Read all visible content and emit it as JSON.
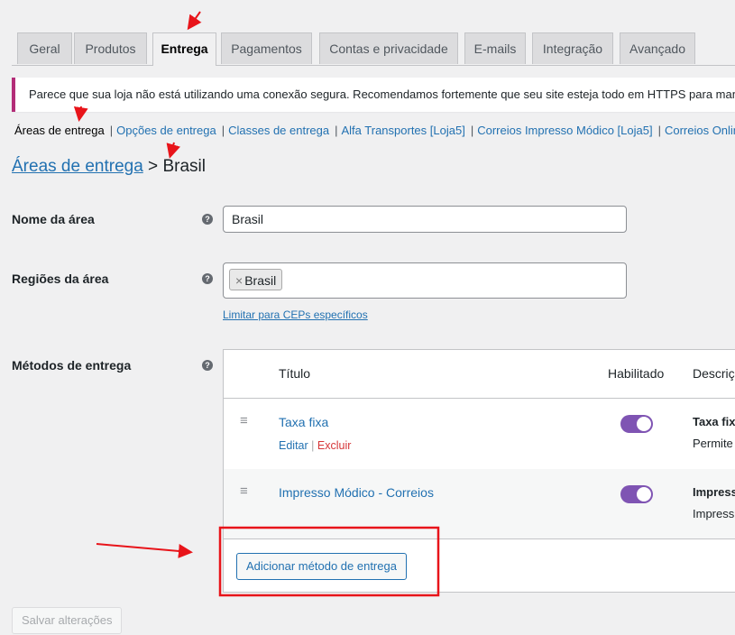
{
  "tabs": [
    "Geral",
    "Produtos",
    "Entrega",
    "Pagamentos",
    "Contas e privacidade",
    "E-mails",
    "Integração",
    "Avançado"
  ],
  "notice": "Parece que sua loja não está utilizando uma conexão segura. Recomendamos fortemente que seu site esteja todo em HTTPS para manter",
  "subnav": {
    "current": "Áreas de entrega",
    "links": [
      "Opções de entrega",
      "Classes de entrega",
      "Alfa Transportes [Loja5]",
      "Correios Impresso Módico [Loja5]",
      "Correios Online e"
    ]
  },
  "breadcrumb": {
    "parent": "Áreas de entrega",
    "separator": ">",
    "current": "Brasil"
  },
  "fields": {
    "name_label": "Nome da área",
    "name_value": "Brasil",
    "regions_label": "Regiões da área",
    "region_chip_remove": "×",
    "region_chip": "Brasil",
    "limit_link": "Limitar para CEPs específicos",
    "methods_label": "Métodos de entrega",
    "help": "?"
  },
  "methods_table": {
    "col_title": "Título",
    "col_enabled": "Habilitado",
    "col_desc": "Descriç",
    "rows": [
      {
        "title": "Taxa fixa",
        "edit": "Editar",
        "sep": "|",
        "delete": "Excluir",
        "enabled": true,
        "desc_title": "Taxa fix",
        "desc_text": "Permite"
      },
      {
        "title": "Impresso Módico - Correios",
        "enabled": true,
        "desc_title": "Impress",
        "desc_text": "Impress"
      }
    ],
    "add_button": "Adicionar método de entrega"
  },
  "save_button": "Salvar alterações",
  "colors": {
    "accent": "#2271b1",
    "toggle": "#7f54b3",
    "annotation": "#e8141a",
    "notice_border": "#b32d78"
  }
}
